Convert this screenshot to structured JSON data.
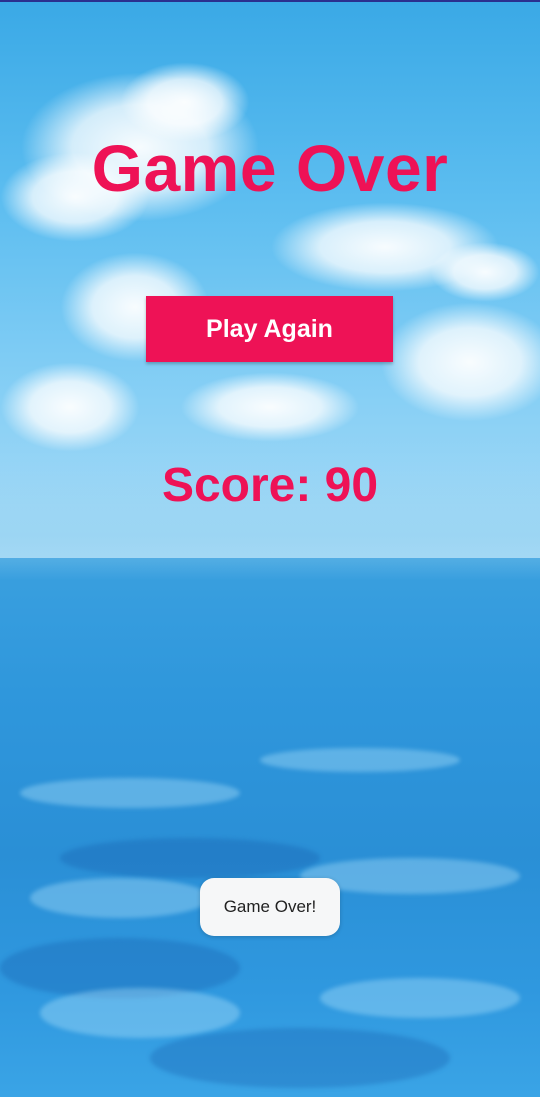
{
  "screen": {
    "title": "Game Over",
    "play_again_label": "Play Again",
    "score_text": "Score: 90"
  },
  "toast": {
    "message": "Game Over!"
  },
  "colors": {
    "accent": "#ee1256",
    "button_text": "#ffffff",
    "toast_bg": "#f6f7f8"
  }
}
